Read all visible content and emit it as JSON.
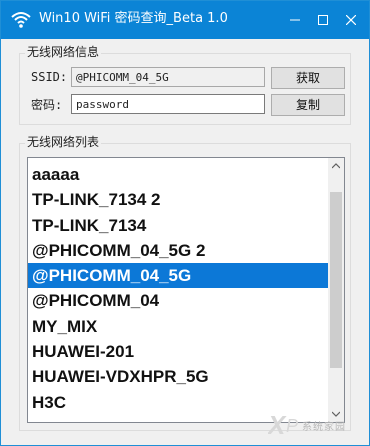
{
  "window": {
    "title": "Win10 WiFi 密码查询_Beta 1.0",
    "accent_color": "#0b84d6",
    "icons": [
      "wifi-app-icon",
      "minimize-icon",
      "maximize-icon",
      "close-icon"
    ]
  },
  "info_group": {
    "legend": "无线网络信息",
    "ssid_label": "SSID:",
    "ssid_value": "@PHICOMM_04_5G",
    "password_label": "密码:",
    "password_value": "password",
    "get_button": "获取",
    "copy_button": "复制"
  },
  "list_group": {
    "legend": "无线网络列表",
    "selected_color": "#0c78d7",
    "items": [
      "aaaaa",
      "TP-LINK_7134 2",
      "TP-LINK_7134",
      "@PHICOMM_04_5G 2",
      "@PHICOMM_04_5G",
      "@PHICOMM_04",
      "MY_MIX",
      "HUAWEI-201",
      "HUAWEI-VDXHPR_5G",
      "H3C"
    ],
    "selected_index": 4
  },
  "watermark": {
    "text": "系统家园"
  }
}
